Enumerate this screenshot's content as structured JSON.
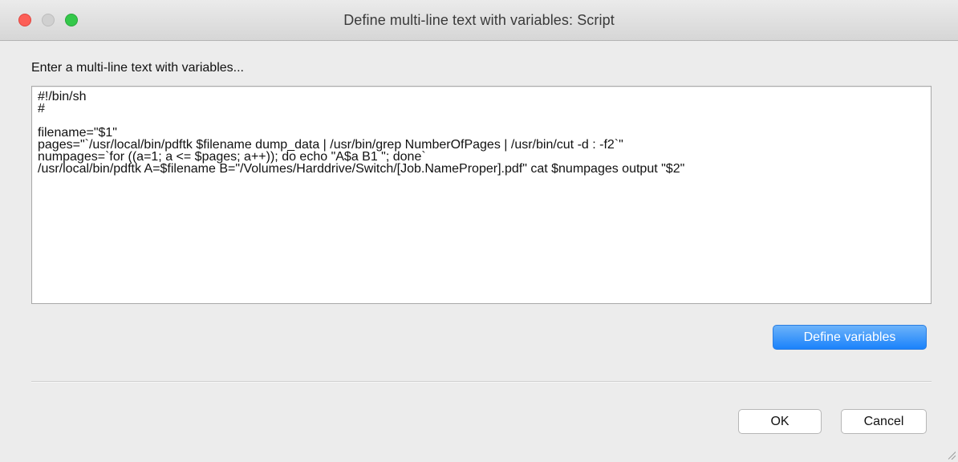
{
  "window": {
    "title": "Define multi-line text with variables: Script"
  },
  "dialog": {
    "prompt": "Enter a multi-line text with variables...",
    "script_text": "#!/bin/sh\n#\n\nfilename=\"$1\"\npages=\"`/usr/local/bin/pdftk $filename dump_data | /usr/bin/grep NumberOfPages | /usr/bin/cut -d : -f2`\"\nnumpages=`for ((a=1; a <= $pages; a++)); do echo \"A$a B1 \"; done`\n/usr/local/bin/pdftk A=$filename B=\"/Volumes/Harddrive/Switch/[Job.NameProper].pdf\" cat $numpages output \"$2\"",
    "define_variables_label": "Define variables",
    "ok_label": "OK",
    "cancel_label": "Cancel"
  },
  "colors": {
    "close": "#fc5f57",
    "minimize_disabled": "#d0d0d0",
    "zoom": "#34c84a",
    "accent_button": "#1a82fb"
  },
  "icons": {
    "close": "close-icon",
    "minimize": "minimize-icon",
    "zoom": "zoom-icon",
    "resize": "resize-grip-icon"
  }
}
